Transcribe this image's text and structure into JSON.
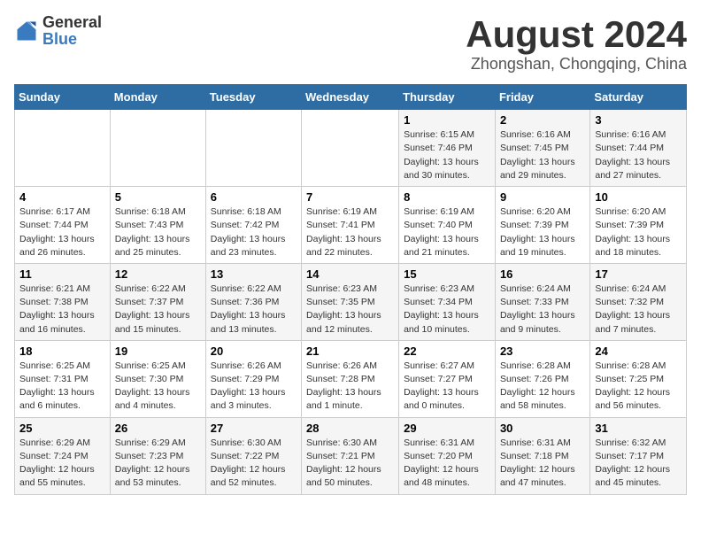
{
  "logo": {
    "general": "General",
    "blue": "Blue"
  },
  "title": "August 2024",
  "location": "Zhongshan, Chongqing, China",
  "weekdays": [
    "Sunday",
    "Monday",
    "Tuesday",
    "Wednesday",
    "Thursday",
    "Friday",
    "Saturday"
  ],
  "weeks": [
    [
      {
        "day": "",
        "info": ""
      },
      {
        "day": "",
        "info": ""
      },
      {
        "day": "",
        "info": ""
      },
      {
        "day": "",
        "info": ""
      },
      {
        "day": "1",
        "info": "Sunrise: 6:15 AM\nSunset: 7:46 PM\nDaylight: 13 hours\nand 30 minutes."
      },
      {
        "day": "2",
        "info": "Sunrise: 6:16 AM\nSunset: 7:45 PM\nDaylight: 13 hours\nand 29 minutes."
      },
      {
        "day": "3",
        "info": "Sunrise: 6:16 AM\nSunset: 7:44 PM\nDaylight: 13 hours\nand 27 minutes."
      }
    ],
    [
      {
        "day": "4",
        "info": "Sunrise: 6:17 AM\nSunset: 7:44 PM\nDaylight: 13 hours\nand 26 minutes."
      },
      {
        "day": "5",
        "info": "Sunrise: 6:18 AM\nSunset: 7:43 PM\nDaylight: 13 hours\nand 25 minutes."
      },
      {
        "day": "6",
        "info": "Sunrise: 6:18 AM\nSunset: 7:42 PM\nDaylight: 13 hours\nand 23 minutes."
      },
      {
        "day": "7",
        "info": "Sunrise: 6:19 AM\nSunset: 7:41 PM\nDaylight: 13 hours\nand 22 minutes."
      },
      {
        "day": "8",
        "info": "Sunrise: 6:19 AM\nSunset: 7:40 PM\nDaylight: 13 hours\nand 21 minutes."
      },
      {
        "day": "9",
        "info": "Sunrise: 6:20 AM\nSunset: 7:39 PM\nDaylight: 13 hours\nand 19 minutes."
      },
      {
        "day": "10",
        "info": "Sunrise: 6:20 AM\nSunset: 7:39 PM\nDaylight: 13 hours\nand 18 minutes."
      }
    ],
    [
      {
        "day": "11",
        "info": "Sunrise: 6:21 AM\nSunset: 7:38 PM\nDaylight: 13 hours\nand 16 minutes."
      },
      {
        "day": "12",
        "info": "Sunrise: 6:22 AM\nSunset: 7:37 PM\nDaylight: 13 hours\nand 15 minutes."
      },
      {
        "day": "13",
        "info": "Sunrise: 6:22 AM\nSunset: 7:36 PM\nDaylight: 13 hours\nand 13 minutes."
      },
      {
        "day": "14",
        "info": "Sunrise: 6:23 AM\nSunset: 7:35 PM\nDaylight: 13 hours\nand 12 minutes."
      },
      {
        "day": "15",
        "info": "Sunrise: 6:23 AM\nSunset: 7:34 PM\nDaylight: 13 hours\nand 10 minutes."
      },
      {
        "day": "16",
        "info": "Sunrise: 6:24 AM\nSunset: 7:33 PM\nDaylight: 13 hours\nand 9 minutes."
      },
      {
        "day": "17",
        "info": "Sunrise: 6:24 AM\nSunset: 7:32 PM\nDaylight: 13 hours\nand 7 minutes."
      }
    ],
    [
      {
        "day": "18",
        "info": "Sunrise: 6:25 AM\nSunset: 7:31 PM\nDaylight: 13 hours\nand 6 minutes."
      },
      {
        "day": "19",
        "info": "Sunrise: 6:25 AM\nSunset: 7:30 PM\nDaylight: 13 hours\nand 4 minutes."
      },
      {
        "day": "20",
        "info": "Sunrise: 6:26 AM\nSunset: 7:29 PM\nDaylight: 13 hours\nand 3 minutes."
      },
      {
        "day": "21",
        "info": "Sunrise: 6:26 AM\nSunset: 7:28 PM\nDaylight: 13 hours\nand 1 minute."
      },
      {
        "day": "22",
        "info": "Sunrise: 6:27 AM\nSunset: 7:27 PM\nDaylight: 13 hours\nand 0 minutes."
      },
      {
        "day": "23",
        "info": "Sunrise: 6:28 AM\nSunset: 7:26 PM\nDaylight: 12 hours\nand 58 minutes."
      },
      {
        "day": "24",
        "info": "Sunrise: 6:28 AM\nSunset: 7:25 PM\nDaylight: 12 hours\nand 56 minutes."
      }
    ],
    [
      {
        "day": "25",
        "info": "Sunrise: 6:29 AM\nSunset: 7:24 PM\nDaylight: 12 hours\nand 55 minutes."
      },
      {
        "day": "26",
        "info": "Sunrise: 6:29 AM\nSunset: 7:23 PM\nDaylight: 12 hours\nand 53 minutes."
      },
      {
        "day": "27",
        "info": "Sunrise: 6:30 AM\nSunset: 7:22 PM\nDaylight: 12 hours\nand 52 minutes."
      },
      {
        "day": "28",
        "info": "Sunrise: 6:30 AM\nSunset: 7:21 PM\nDaylight: 12 hours\nand 50 minutes."
      },
      {
        "day": "29",
        "info": "Sunrise: 6:31 AM\nSunset: 7:20 PM\nDaylight: 12 hours\nand 48 minutes."
      },
      {
        "day": "30",
        "info": "Sunrise: 6:31 AM\nSunset: 7:18 PM\nDaylight: 12 hours\nand 47 minutes."
      },
      {
        "day": "31",
        "info": "Sunrise: 6:32 AM\nSunset: 7:17 PM\nDaylight: 12 hours\nand 45 minutes."
      }
    ]
  ]
}
